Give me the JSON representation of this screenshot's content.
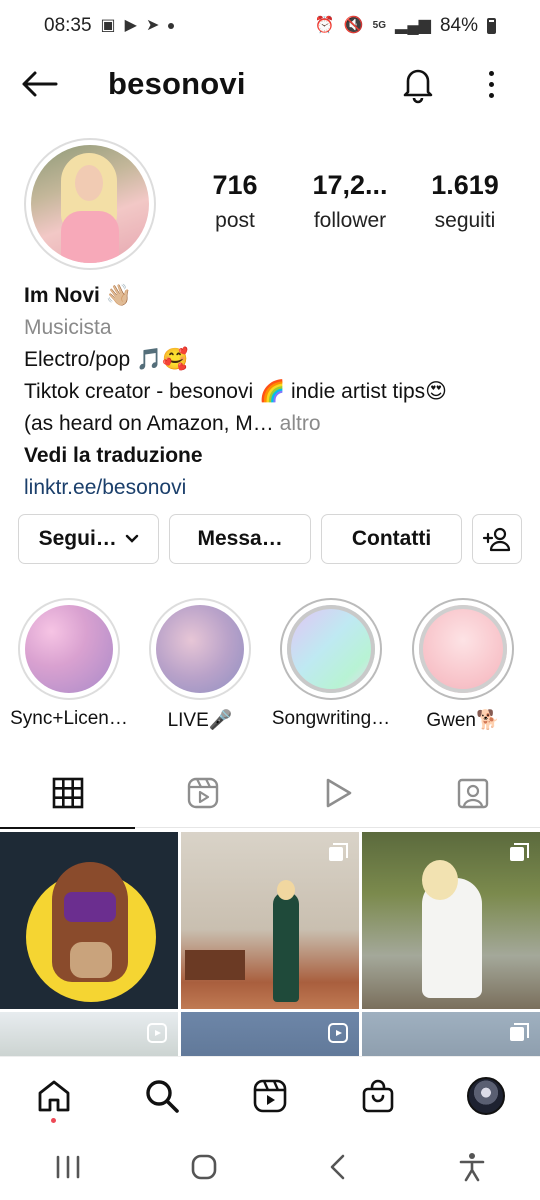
{
  "status_bar": {
    "time": "08:35",
    "network": "5G",
    "battery": "84%"
  },
  "topbar": {
    "username": "besonovi"
  },
  "profile": {
    "stats": [
      {
        "value": "716",
        "label": "post"
      },
      {
        "value": "17,2...",
        "label": "follower"
      },
      {
        "value": "1.619",
        "label": "seguiti"
      }
    ],
    "name": "Im Novi 👋🏼",
    "category": "Musicista",
    "bio_lines": [
      "Electro/pop 🎵🥰",
      "Tiktok creator - besonovi 🌈 indie artist tips😍"
    ],
    "bio_truncated": "(as heard on Amazon, M…",
    "more_label": "altro",
    "translate_label": "Vedi la traduzione",
    "link": "linktr.ee/besonovi"
  },
  "actions": {
    "follow_label": "Segui…",
    "message_label": "Messa…",
    "contact_label": "Contatti"
  },
  "highlights": [
    {
      "label": "Sync+Licen…",
      "color_a": "#f3b6d9",
      "color_b": "#b78fd0"
    },
    {
      "label": "LIVE🎤",
      "color_a": "#d8b3cc",
      "color_b": "#8f93c9"
    },
    {
      "label": "Songwriting…",
      "color_a": "#b9f0d9",
      "color_b": "#e1b6f2"
    },
    {
      "label": "Gwen🐕",
      "color_a": "#fbd7da",
      "color_b": "#f4b6be"
    }
  ],
  "tabs": [
    "grid",
    "reels",
    "videos",
    "tagged"
  ],
  "bottom_nav": [
    "home",
    "search",
    "reels",
    "shop",
    "profile"
  ]
}
